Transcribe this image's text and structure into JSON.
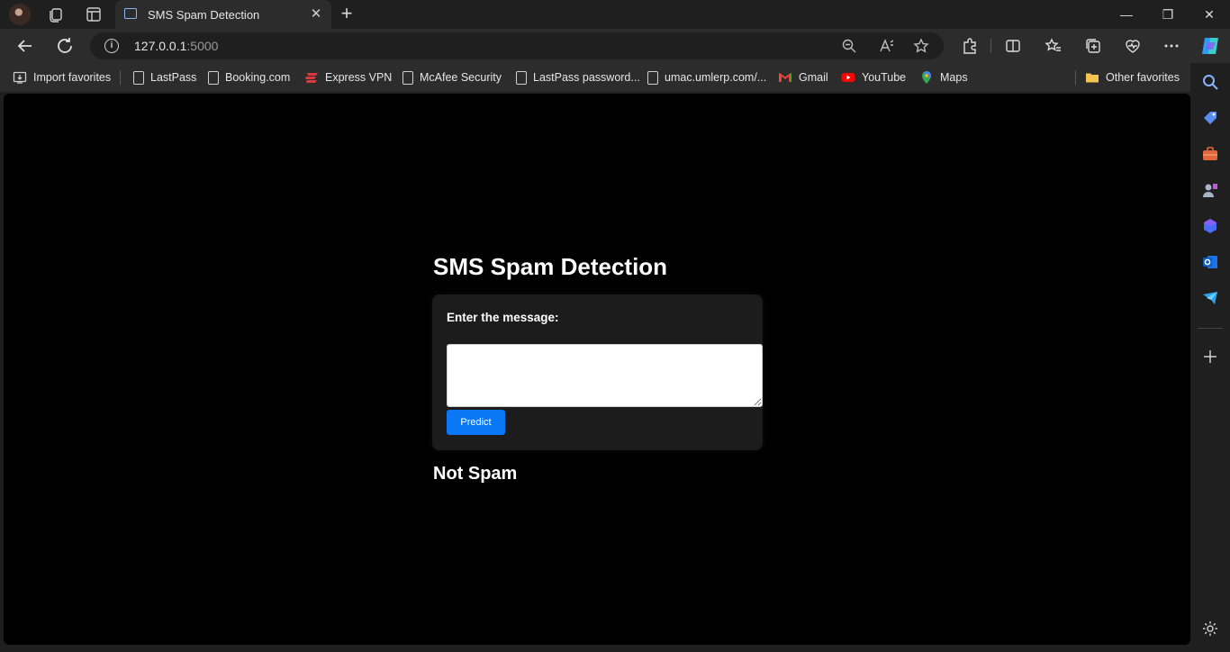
{
  "browser": {
    "tab_title": "SMS Spam Detection",
    "tab_close": "✕",
    "new_tab": "+",
    "window_controls": {
      "minimize": "—",
      "restore": "❐",
      "close": "✕"
    },
    "url_host": "127.0.0.1",
    "url_port": ":5000",
    "info_glyph": "i"
  },
  "favorites": {
    "items": [
      {
        "label": "Import favorites",
        "icon": "import-icon"
      },
      {
        "label": "LastPass",
        "icon": "page-icon"
      },
      {
        "label": "Booking.com",
        "icon": "page-icon"
      },
      {
        "label": "Express VPN",
        "icon": "expressvpn-icon"
      },
      {
        "label": "McAfee Security",
        "icon": "page-icon"
      },
      {
        "label": "LastPass password...",
        "icon": "page-icon"
      },
      {
        "label": "umac.umlerp.com/...",
        "icon": "page-icon"
      },
      {
        "label": "Gmail",
        "icon": "gmail-icon"
      },
      {
        "label": "YouTube",
        "icon": "youtube-icon"
      },
      {
        "label": "Maps",
        "icon": "maps-icon"
      }
    ],
    "other": "Other favorites"
  },
  "page": {
    "title": "SMS Spam Detection",
    "form": {
      "label": "Enter the message:",
      "textarea_value": "",
      "submit_label": "Predict"
    },
    "result": "Not Spam"
  },
  "colors": {
    "page_background": "#000000",
    "card_background": "#1c1c1c",
    "button_blue": "#0a78f6",
    "browser_chrome": "#2c2c2c"
  }
}
